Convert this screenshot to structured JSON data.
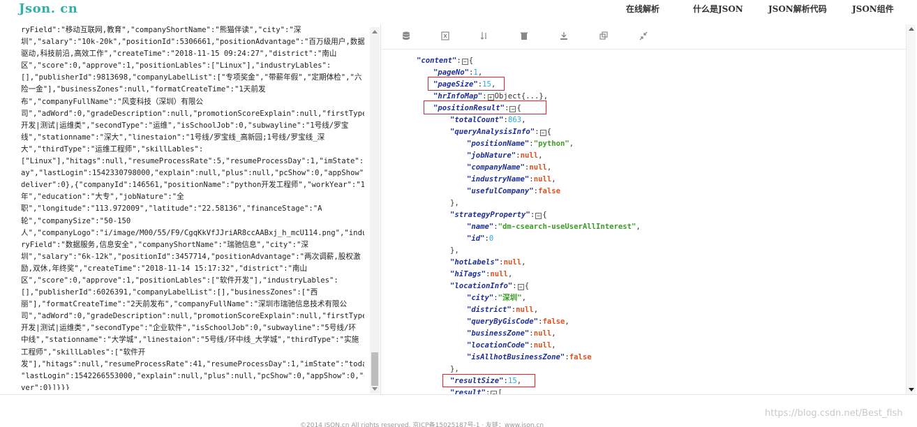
{
  "header": {
    "logo": "Json. cn",
    "nav": [
      "在线解析",
      "什么是JSON",
      "JSON解析代码",
      "JSON组件"
    ]
  },
  "raw_text": {
    "lines": [
      "ryField\":\"移动互联网,教育\",\"companyShortName\":\"熊猫伴读\",\"city\":\"深",
      "圳\",\"salary\":\"10k-20k\",\"positionId\":5306661,\"positionAdvantage\":\"百万级用户,数据",
      "驱动,科技前沿,高效工作\",\"createTime\":\"2018-11-15 09:24:27\",\"district\":\"南山",
      "区\",\"score\":0,\"approve\":1,\"positionLables\":[\"Linux\"],\"industryLables\":",
      "[],\"publisherId\":9813698,\"companyLabelList\":[\"专项奖金\",\"带薪年假\",\"定期体检\",\"六",
      "险一金\"],\"businessZones\":null,\"formatCreateTime\":\"1天前发",
      "布\",\"companyFullName\":\"风变科技（深圳）有限公",
      "司\",\"adWord\":0,\"gradeDescription\":null,\"promotionScoreExplain\":null,\"firstType\":\"",
      "开发|测试|运维类\",\"secondType\":\"运维\",\"isSchoolJob\":0,\"subwayline\":\"1号线/罗宝",
      "线\",\"stationname\":\"深大\",\"linestaion\":\"1号线/罗宝线_高新园;1号线/罗宝线_深",
      "大\",\"thirdType\":\"运维工程师\",\"skillLables\":",
      "[\"Linux\"],\"hitags\":null,\"resumeProcessRate\":5,\"resumeProcessDay\":1,\"imState\":\"tod",
      "ay\",\"lastLogin\":1542330798000,\"explain\":null,\"plus\":null,\"pcShow\":0,\"appShow\":0,\"",
      "deliver\":0},{\"companyId\":146561,\"positionName\":\"python开发工程师\",\"workYear\":\"1-3",
      "年\",\"education\":\"大专\",\"jobNature\":\"全",
      "职\",\"longitude\":\"113.972009\",\"latitude\":\"22.58136\",\"financeStage\":\"A",
      "轮\",\"companySize\":\"50-150",
      "人\",\"companyLogo\":\"i/image/M00/55/F9/CgqKkVfJJriAR8ccAABxj_h_mcU114.png\",\"indust",
      "ryField\":\"数据服务,信息安全\",\"companyShortName\":\"瑞驰信息\",\"city\":\"深",
      "圳\",\"salary\":\"6k-12k\",\"positionId\":3457714,\"positionAdvantage\":\"两次调薪,股权激",
      "励,双休,年终奖\",\"createTime\":\"2018-11-14 15:17:32\",\"district\":\"南山",
      "区\",\"score\":0,\"approve\":1,\"positionLables\":[\"软件开发\"],\"industryLables\":",
      "[],\"publisherId\":6026391,\"companyLabelList\":[],\"businessZones\":[\"西",
      "丽\"],\"formatCreateTime\":\"2天前发布\",\"companyFullName\":\"深圳市瑞驰信息技术有限公",
      "司\",\"adWord\":0,\"gradeDescription\":null,\"promotionScoreExplain\":null,\"firstType\":\"",
      "开发|测试|运维类\",\"secondType\":\"企业软件\",\"isSchoolJob\":0,\"subwayline\":\"5号线/环",
      "中线\",\"stationname\":\"大学城\",\"linestaion\":\"5号线/环中线_大学城\",\"thirdType\":\"实施",
      "工程师\",\"skillLables\":[\"软件开",
      "发\"],\"hitags\":null,\"resumeProcessRate\":41,\"resumeProcessDay\":1,\"imState\":\"today\",",
      "\"lastLogin\":1542266553000,\"explain\":null,\"plus\":null,\"pcShow\":0,\"appShow\":0,\"deli",
      "ver\":0}]}}}"
    ]
  },
  "toolbar": [
    "database-icon",
    "format-icon",
    "sort-icon",
    "delete-icon",
    "download-icon",
    "copy-icon",
    "compress-icon"
  ],
  "tree": [
    {
      "indent": 0,
      "key": "content",
      "open": "{"
    },
    {
      "indent": 1,
      "key": "pageNo",
      "num": "1"
    },
    {
      "indent": 1,
      "key": "pageSize",
      "num": "15"
    },
    {
      "indent": 1,
      "key": "hrInfoMap",
      "collapsed": "Object{...}"
    },
    {
      "indent": 1,
      "key": "positionResult",
      "open": "{"
    },
    {
      "indent": 2,
      "key": "totalCount",
      "num": "863"
    },
    {
      "indent": 2,
      "key": "queryAnalysisInfo",
      "open": "{"
    },
    {
      "indent": 3,
      "key": "positionName",
      "str": "\"python\""
    },
    {
      "indent": 3,
      "key": "jobNature",
      "nul": "null"
    },
    {
      "indent": 3,
      "key": "companyName",
      "nul": "null"
    },
    {
      "indent": 3,
      "key": "industryName",
      "nul": "null"
    },
    {
      "indent": 3,
      "key": "usefulCompany",
      "nul": "false",
      "last": true
    },
    {
      "indent": 2,
      "close": "},"
    },
    {
      "indent": 2,
      "key": "strategyProperty",
      "open": "{"
    },
    {
      "indent": 3,
      "key": "name",
      "str": "\"dm-csearch-useUserAllInterest\""
    },
    {
      "indent": 3,
      "key": "id",
      "num": "0",
      "last": true
    },
    {
      "indent": 2,
      "close": "},"
    },
    {
      "indent": 2,
      "key": "hotLabels",
      "nul": "null"
    },
    {
      "indent": 2,
      "key": "hiTags",
      "nul": "null"
    },
    {
      "indent": 2,
      "key": "locationInfo",
      "open": "{"
    },
    {
      "indent": 3,
      "key": "city",
      "str": "\"深圳\""
    },
    {
      "indent": 3,
      "key": "district",
      "nul": "null"
    },
    {
      "indent": 3,
      "key": "queryByGisCode",
      "nul": "false"
    },
    {
      "indent": 3,
      "key": "businessZone",
      "nul": "null"
    },
    {
      "indent": 3,
      "key": "locationCode",
      "nul": "null"
    },
    {
      "indent": 3,
      "key": "isAllhotBusinessZone",
      "nul": "false",
      "last": true
    },
    {
      "indent": 2,
      "close": "},"
    },
    {
      "indent": 2,
      "key": "resultSize",
      "num": "15"
    },
    {
      "indent": 2,
      "key": "result",
      "open": "["
    }
  ],
  "footer": {
    "text": "©2014 JSON.cn All rights reserved. 京ICP备15025187号-1 · 友链：www.json.cn"
  },
  "watermark": "https://blog.csdn.net/Best_fish"
}
